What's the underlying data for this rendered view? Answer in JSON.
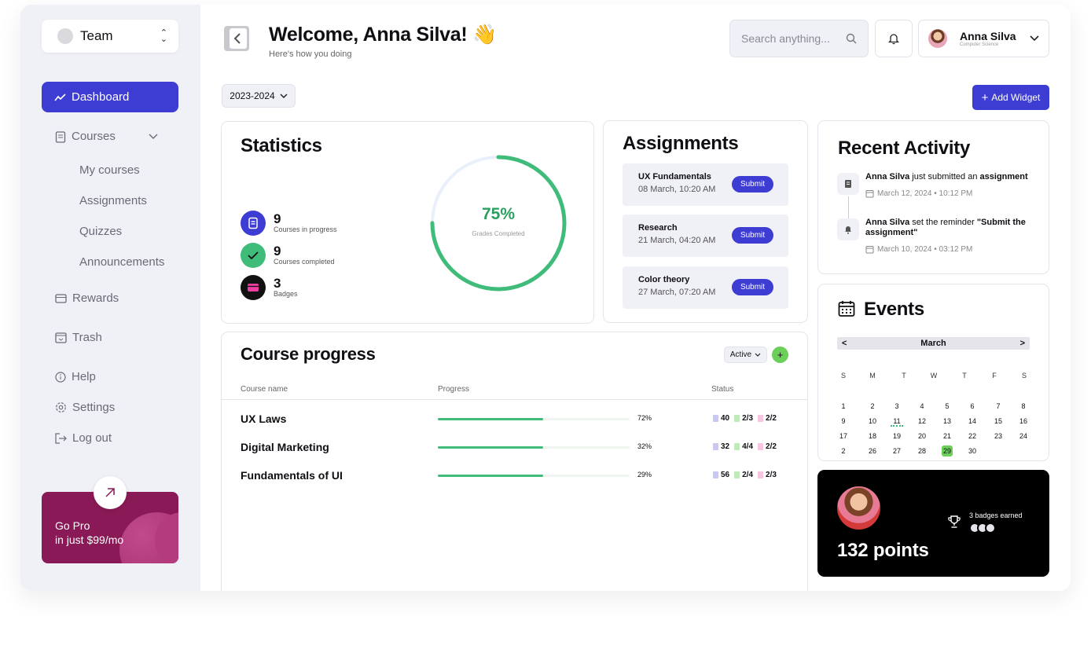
{
  "sidebar": {
    "team": "Team",
    "dashboard": "Dashboard",
    "courses": "Courses",
    "sub": [
      "My courses",
      "Assignments",
      "Quizzes",
      "Announcements"
    ],
    "rewards": "Rewards",
    "trash": "Trash",
    "help": "Help",
    "settings": "Settings",
    "logout": "Log out",
    "gopro_line1": "Go Pro",
    "gopro_line2": "in just $99/mo"
  },
  "header": {
    "welcome": "Welcome, Anna Silva!",
    "wave": "👋",
    "subtitle": "Here's how you doing",
    "search_placeholder": "Search anything...",
    "user_name": "Anna Silva",
    "user_role": "Computer Science",
    "year": "2023-2024",
    "add_widget": "Add Widget"
  },
  "statistics": {
    "title": "Statistics",
    "items": [
      {
        "value": "9",
        "label": "Courses in progress"
      },
      {
        "value": "9",
        "label": "Courses completed"
      },
      {
        "value": "3",
        "label": "Badges"
      }
    ],
    "grade_percent": "75%",
    "grade_fraction": 0.75,
    "grade_label": "Grades Completed"
  },
  "assignments": {
    "title": "Assignments",
    "items": [
      {
        "name": "UX Fundamentals",
        "date": "08 March, 10:20 AM",
        "action": "Submit"
      },
      {
        "name": "Research",
        "date": "21 March, 04:20 AM",
        "action": "Submit"
      },
      {
        "name": "Color theory",
        "date": "27 March, 07:20 AM",
        "action": "Submit"
      }
    ]
  },
  "activity": {
    "title": "Recent Activity",
    "items": [
      {
        "actor": "Anna Silva",
        "text": " just submitted an ",
        "object": "assignment",
        "date": "March 12, 2024 • 10:12 PM"
      },
      {
        "actor": "Anna Silva",
        "text": " set the reminder ",
        "object": "\"Submit the assignment\"",
        "date": "March 10, 2024 • 03:12 PM"
      }
    ]
  },
  "course_progress": {
    "title": "Course progress",
    "filter": "Active",
    "headers": [
      "Course name",
      "Progress",
      "Status"
    ],
    "rows": [
      {
        "name": "UX Laws",
        "progress": "72%",
        "fill": 0.55,
        "s1": "40",
        "s2": "2/3",
        "s3": "2/2"
      },
      {
        "name": "Digital Marketing",
        "progress": "32%",
        "fill": 0.55,
        "s1": "32",
        "s2": "4/4",
        "s3": "2/2"
      },
      {
        "name": "Fundamentals of UI",
        "progress": "29%",
        "fill": 0.55,
        "s1": "56",
        "s2": "2/4",
        "s3": "2/3"
      }
    ]
  },
  "events": {
    "title": "Events",
    "month": "March",
    "prev": "<",
    "next": ">",
    "dow": [
      "S",
      "M",
      "T",
      "W",
      "T",
      "F",
      "S"
    ],
    "weeks": [
      [
        "1",
        "2",
        "3",
        "4",
        "5",
        "6",
        "7",
        "8"
      ],
      [
        "9",
        "10",
        "11",
        "12",
        "13",
        "14",
        "15",
        "16"
      ],
      [
        "17",
        "18",
        "19",
        "20",
        "21",
        "22",
        "23",
        "24"
      ],
      [
        "2",
        "26",
        "27",
        "28",
        "29",
        "30"
      ]
    ],
    "highlight": "29",
    "dotted": "11"
  },
  "points": {
    "value": "132 points",
    "badges": "3 badges earned"
  },
  "colors": {
    "accent": "#3d3cd3",
    "green": "#3fbc7a",
    "sidebar": "#f0f0f7"
  }
}
